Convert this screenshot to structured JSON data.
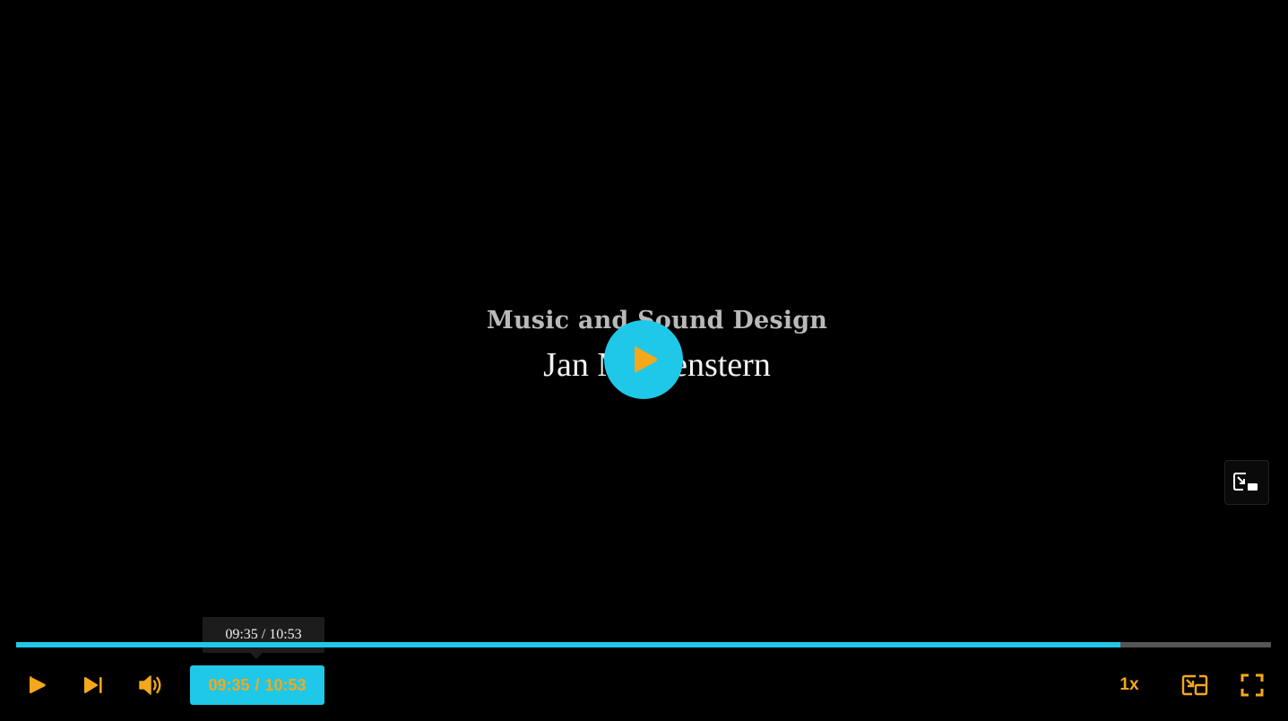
{
  "video": {
    "credit_role": "Music and Sound Design",
    "credit_name": "Jan Morgenstern"
  },
  "controls": {
    "current_time": "09:35",
    "separator": "/",
    "duration": "10:53",
    "speed": "1x",
    "progress_fraction": 0.88,
    "tooltip": "09:35 / 10:53"
  },
  "icons": {
    "big_play": "play-icon",
    "pip_overlay": "picture-in-picture-icon",
    "play": "play-icon",
    "next": "skip-next-icon",
    "volume": "volume-icon",
    "pip": "picture-in-picture-icon",
    "fullscreen": "fullscreen-icon"
  },
  "colors": {
    "accent": "#1fc8e8",
    "icon": "#f5a81b",
    "track": "#555555",
    "background": "#000000"
  }
}
